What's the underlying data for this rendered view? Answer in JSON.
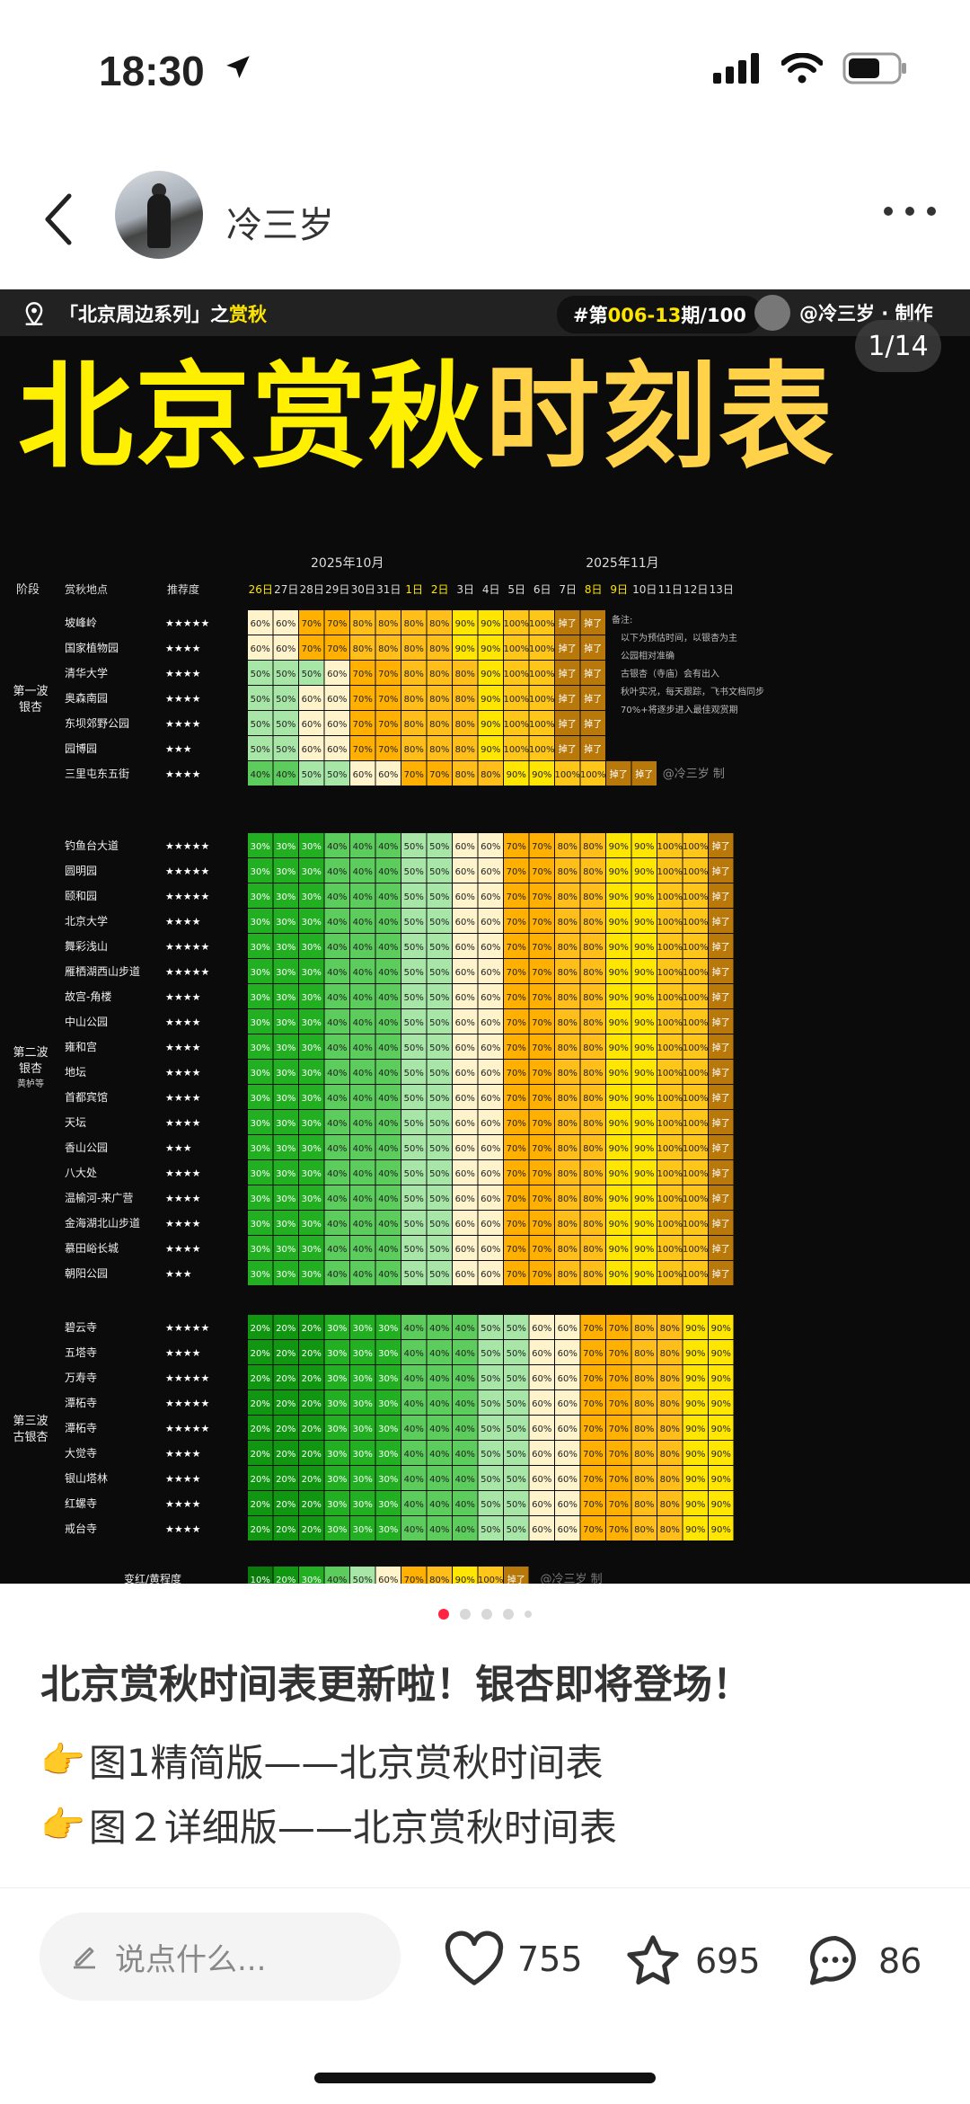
{
  "status": {
    "time": "18:30"
  },
  "header": {
    "username": "冷三岁"
  },
  "poster": {
    "series_prefix": "「北京周边系列」之",
    "series_highlight": "赏秋",
    "issue_prefix": "#第",
    "issue_num": "006-13",
    "issue_suffix": "期/100",
    "author": "@冷三岁 · 制作",
    "page_counter": "1/14",
    "title_part1": "北京赏秋",
    "title_part2": "时刻表"
  },
  "table": {
    "month_oct": "2025年10月",
    "month_nov": "2025年11月",
    "col_stage": "阶段",
    "col_place": "赏秋地点",
    "col_rating": "推荐度",
    "dates": [
      "26日",
      "27日",
      "28日",
      "29日",
      "30日",
      "31日",
      "1日",
      "2日",
      "3日",
      "4日",
      "5日",
      "6日",
      "7日",
      "8日",
      "9日",
      "10日",
      "11日",
      "12日",
      "13日"
    ],
    "groups": [
      {
        "stage": [
          "第一波",
          "银杏"
        ],
        "places": [
          "坡峰岭",
          "国家植物园",
          "清华大学",
          "奥森南园",
          "东坝郊野公园",
          "园博园",
          "三里屯东五街"
        ],
        "ratings": [
          "★★★★★",
          "★★★★",
          "★★★★",
          "★★★★",
          "★★★★",
          "★★★",
          "★★★★"
        ]
      },
      {
        "stage": [
          "第二波",
          "银杏"
        ],
        "stage_note": "黄栌等",
        "places": [
          "钓鱼台大道",
          "圆明园",
          "颐和园",
          "北京大学",
          "舞彩浅山",
          "雁栖湖西山步道",
          "故宫-角楼",
          "中山公园",
          "雍和宫",
          "地坛",
          "首都宾馆",
          "天坛",
          "香山公园",
          "八大处",
          "温榆河-来广营",
          "金海湖北山步道",
          "慕田峪长城",
          "朝阳公园"
        ],
        "ratings": [
          "★★★★★",
          "★★★★★",
          "★★★★★",
          "★★★★",
          "★★★★★",
          "★★★★★",
          "★★★★",
          "★★★★",
          "★★★★",
          "★★★★",
          "★★★★",
          "★★★★",
          "★★★",
          "★★★★",
          "★★★★",
          "★★★★",
          "★★★★",
          "★★★"
        ]
      },
      {
        "stage": [
          "第三波",
          "古银杏"
        ],
        "places": [
          "碧云寺",
          "五塔寺",
          "万寿寺",
          "潭柘寺",
          "潭柘寺",
          "大觉寺",
          "银山塔林",
          "红螺寺",
          "戒台寺"
        ],
        "ratings": [
          "★★★★★",
          "★★★★",
          "★★★★★",
          "★★★★★",
          "★★★★★",
          "★★★★",
          "★★★★",
          "★★★★",
          "★★★★"
        ]
      }
    ],
    "notes": [
      "备注:",
      "以下为预估时间，以银杏为主",
      "公园相对准确",
      "古银杏（寺庙）会有出入",
      "秋叶实况，每天跟踪，飞书文档同步",
      "70%+将逐步进入最佳观赏期"
    ],
    "watermark": "@冷三岁 制",
    "legend_label": "变红/黄程度",
    "legend_values": [
      "10%",
      "20%",
      "30%",
      "40%",
      "50%",
      "60%",
      "70%",
      "80%",
      "90%",
      "100%",
      "掉了"
    ]
  },
  "post": {
    "title": "北京赏秋时间表更新啦！银杏即将登场！",
    "line1": "图1精简版——北京赏秋时间表",
    "line2": "图２详细版——北京赏秋时间表",
    "hand_icon": "👉"
  },
  "bottom": {
    "comment_placeholder": "说点什么...",
    "likes": "755",
    "stars": "695",
    "comments": "86"
  }
}
